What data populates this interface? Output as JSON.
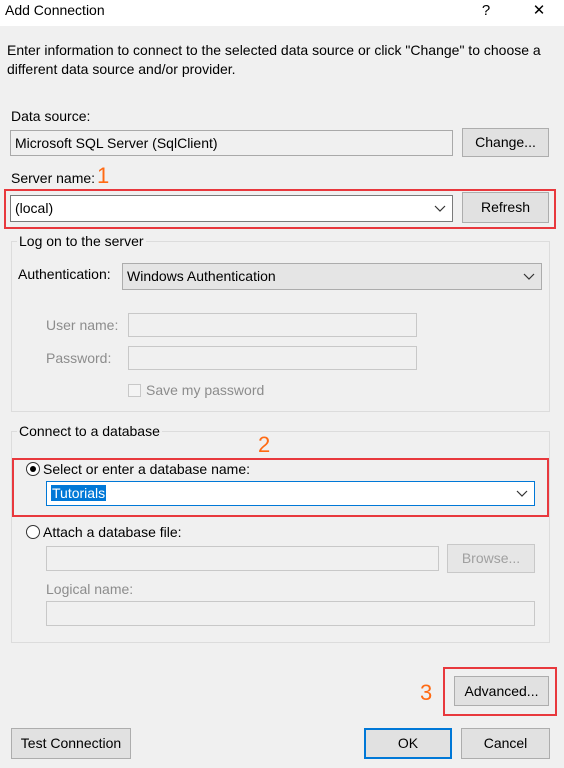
{
  "window": {
    "title": "Add Connection",
    "help_glyph": "?",
    "close_glyph": "✕",
    "description": "Enter information to connect to the selected data source or click \"Change\" to choose a different data source and/or provider."
  },
  "data_source": {
    "label": "Data source:",
    "value": "Microsoft SQL Server (SqlClient)",
    "change_button": "Change..."
  },
  "server": {
    "label": "Server name:",
    "value": "(local)",
    "refresh_button": "Refresh"
  },
  "logon": {
    "group_title": "Log on to the server",
    "auth_label": "Authentication:",
    "auth_value": "Windows Authentication",
    "username_label": "User name:",
    "username_value": "",
    "password_label": "Password:",
    "password_value": "",
    "save_password_label": "Save my password",
    "save_password_checked": false
  },
  "database": {
    "group_title": "Connect to a database",
    "select_radio_label": "Select or enter a database name:",
    "select_radio_selected": true,
    "database_name": "Tutorials",
    "attach_radio_label": "Attach a database file:",
    "attach_radio_selected": false,
    "attach_file_value": "",
    "browse_button": "Browse...",
    "logical_name_label": "Logical name:",
    "logical_name_value": ""
  },
  "annotations": {
    "marker_1": "1",
    "marker_2": "2",
    "marker_3": "3",
    "highlight_color": "#e8383d",
    "number_color": "#ff6a13"
  },
  "footer": {
    "advanced_button": "Advanced...",
    "test_button": "Test Connection",
    "ok_button": "OK",
    "cancel_button": "Cancel"
  }
}
